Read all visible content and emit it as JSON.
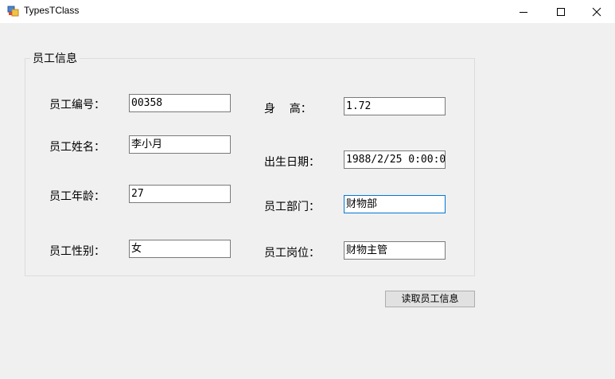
{
  "window": {
    "title": "TypesTClass"
  },
  "group": {
    "title": "员工信息"
  },
  "fields": {
    "employee_id": {
      "label": "员工编号：",
      "value": "00358"
    },
    "name": {
      "label": "员工姓名：",
      "value": "李小月"
    },
    "age": {
      "label": "员工年龄：",
      "value": "27"
    },
    "gender": {
      "label": "员工性别：",
      "value": "女"
    },
    "height": {
      "label": "身    高：",
      "value": "1.72"
    },
    "birth_date": {
      "label": "出生日期：",
      "value": "1988/2/25 0:00:0"
    },
    "department": {
      "label": "员工部门：",
      "value": "财物部"
    },
    "position": {
      "label": "员工岗位：",
      "value": "财物主管"
    }
  },
  "buttons": {
    "read_label": "读取员工信息"
  },
  "icons": {
    "app": "app-icon",
    "minimize": "minimize-icon",
    "maximize": "maximize-icon",
    "close": "close-icon"
  },
  "colors": {
    "focus_border": "#0078d7",
    "window_bg": "#f0f0f0"
  }
}
